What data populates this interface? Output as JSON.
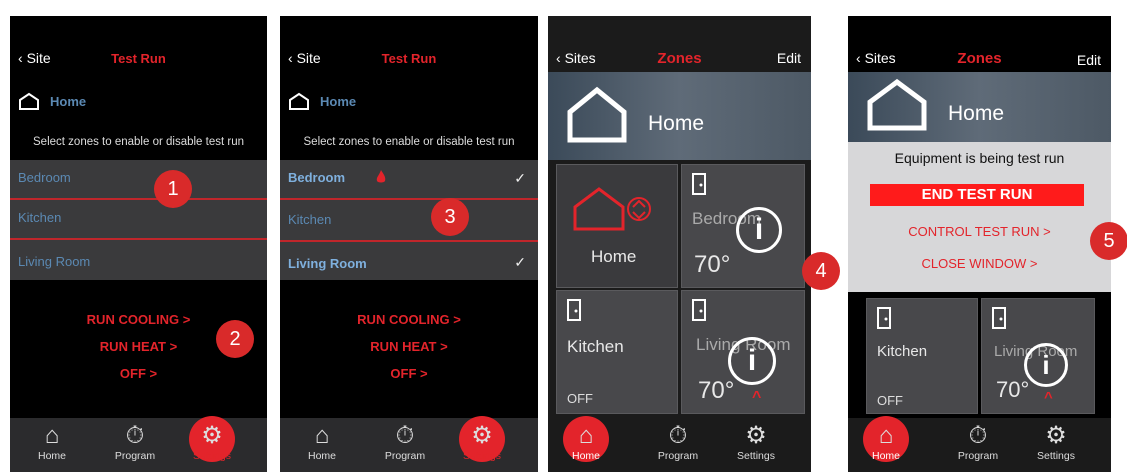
{
  "screen1": {
    "back": "Site",
    "title": "Test Run",
    "home": "Home",
    "prompt": "Select zones to enable or disable test run",
    "zones": [
      {
        "name": "Bedroom"
      },
      {
        "name": "Kitchen"
      },
      {
        "name": "Living Room"
      }
    ],
    "actions": {
      "cool": "RUN COOLING  >",
      "heat": "RUN HEAT  >",
      "off": "OFF  >"
    }
  },
  "screen2": {
    "back": "Site",
    "title": "Test Run",
    "home": "Home",
    "prompt": "Select zones to enable or disable test run",
    "zones": [
      {
        "name": "Bedroom",
        "check": "✓"
      },
      {
        "name": "Kitchen"
      },
      {
        "name": "Living Room",
        "check": "✓"
      }
    ],
    "actions": {
      "cool": "RUN COOLING  >",
      "heat": "RUN HEAT  >",
      "off": "OFF  >"
    }
  },
  "screen3": {
    "back": "Sites",
    "title": "Zones",
    "edit": "Edit",
    "home": "Home",
    "tiles": {
      "home": "Home",
      "bedroom": {
        "name": "Bedroom",
        "temp": "70°"
      },
      "kitchen": {
        "name": "Kitchen",
        "status": "OFF"
      },
      "living": {
        "name": "Living Room",
        "temp": "70°"
      }
    }
  },
  "screen4": {
    "back": "Sites",
    "title": "Zones",
    "edit": "Edit",
    "home": "Home",
    "status": "Equipment is being test run",
    "end": "END TEST RUN",
    "control": "CONTROL TEST RUN  >",
    "close": "CLOSE WINDOW  >",
    "tiles": {
      "kitchen": {
        "name": "Kitchen",
        "status": "OFF"
      },
      "living": {
        "name": "Living Room",
        "temp": "70°"
      }
    }
  },
  "nav": {
    "home": "Home",
    "program": "Program",
    "settings": "Settings"
  },
  "info_glyph": "i",
  "flame_glyph": "^",
  "badges": [
    "1",
    "2",
    "3",
    "4",
    "5"
  ],
  "colors": {
    "accent": "#e3242b",
    "zone_text": "#5b89b3"
  }
}
